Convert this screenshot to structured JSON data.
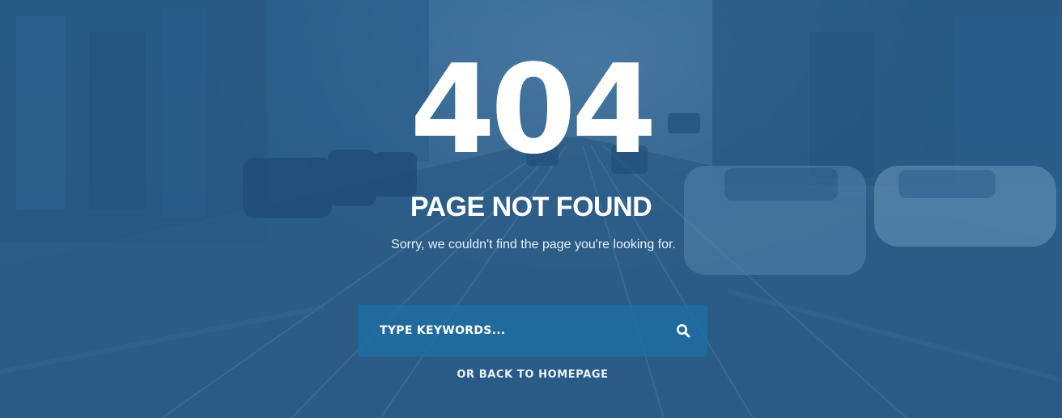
{
  "error": {
    "code": "404",
    "title": "PAGE NOT FOUND",
    "message": "Sorry, we couldn't find the page you're looking for."
  },
  "search": {
    "placeholder": "TYPE KEYWORDS...",
    "value": "",
    "icon": "search-icon"
  },
  "links": {
    "back_home": "OR BACK TO HOMEPAGE"
  },
  "colors": {
    "overlay": "#2c5f8c",
    "search_bg": "#1e6ea5",
    "text": "#ffffff"
  }
}
